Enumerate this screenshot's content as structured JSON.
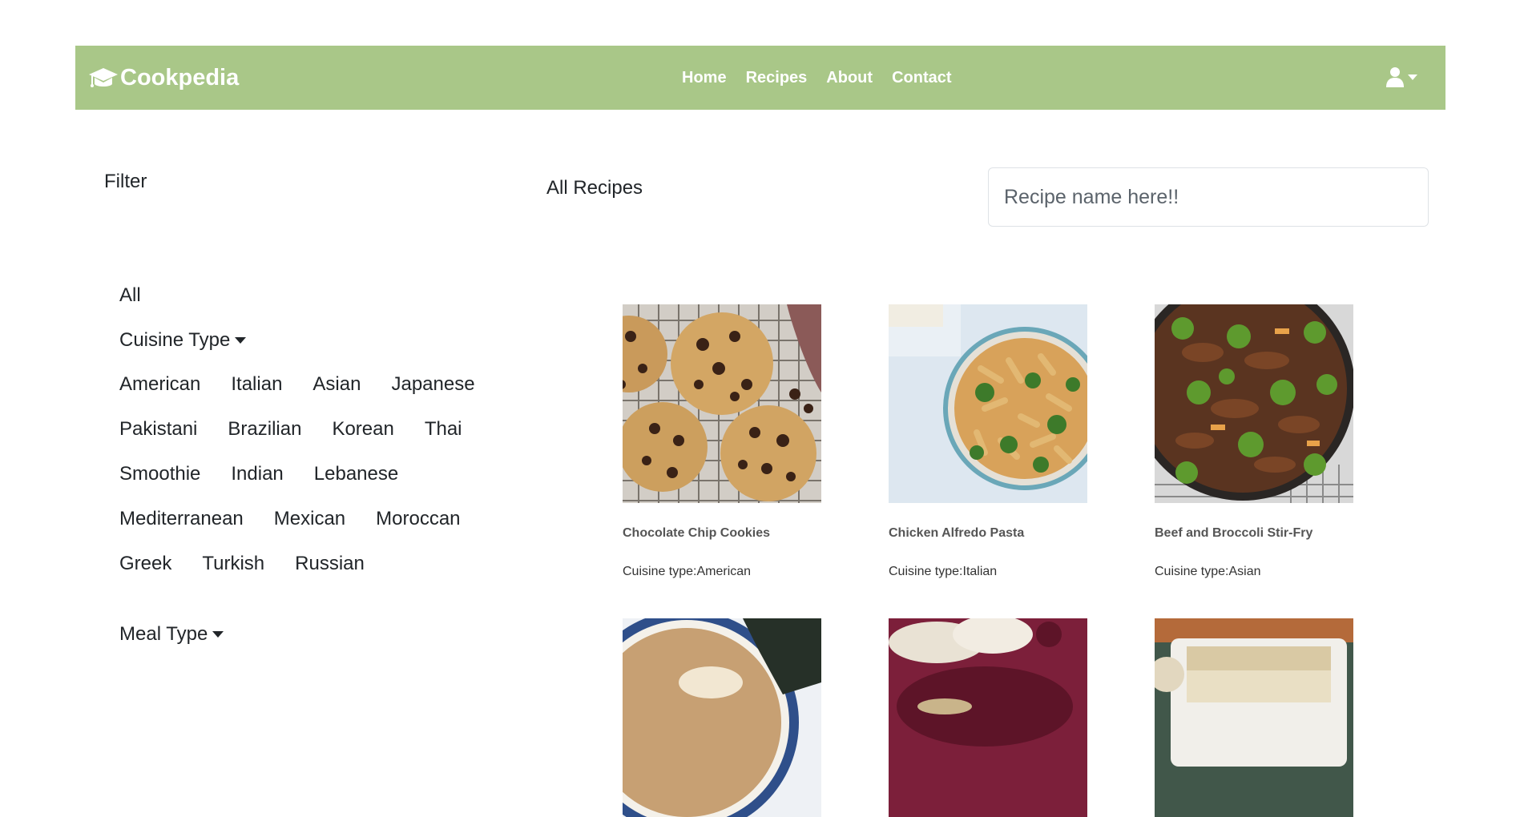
{
  "navbar": {
    "brand": "Cookpedia",
    "links": [
      "Home",
      "Recipes",
      "About",
      "Contact"
    ]
  },
  "filter": {
    "title": "Filter",
    "all_label": "All",
    "cuisine_toggle": "Cuisine Type",
    "meal_toggle": "Meal Type",
    "cuisines": [
      [
        "American",
        "Italian",
        "Asian",
        "Japanese"
      ],
      [
        "Pakistani",
        "Brazilian",
        "Korean",
        "Thai"
      ],
      [
        "Smoothie",
        "Indian",
        "Lebanese"
      ],
      [
        "Mediterranean",
        "Mexican",
        "Moroccan"
      ],
      [
        "Greek",
        "Turkish",
        "Russian"
      ]
    ]
  },
  "main": {
    "title": "All Recipes",
    "search_placeholder": "Recipe name here!!",
    "cuisine_prefix": "Cuisine type:",
    "recipes": [
      {
        "name": "Chocolate Chip Cookies",
        "cuisine": "Cuisine type:American",
        "image": "cookies-photo"
      },
      {
        "name": "Chicken Alfredo Pasta",
        "cuisine": "Cuisine type:Italian",
        "image": "pasta-photo"
      },
      {
        "name": "Beef and Broccoli Stir-Fry",
        "cuisine": "Cuisine type:Asian",
        "image": "stir-fry-photo"
      },
      {
        "name": "",
        "cuisine": "",
        "image": "ramen-photo"
      },
      {
        "name": "",
        "cuisine": "",
        "image": "flatbread-photo"
      },
      {
        "name": "",
        "cuisine": "",
        "image": "casserole-photo"
      }
    ]
  },
  "colors": {
    "navbar": "#a9c788",
    "text": "#212529",
    "card_title": "#555555"
  }
}
